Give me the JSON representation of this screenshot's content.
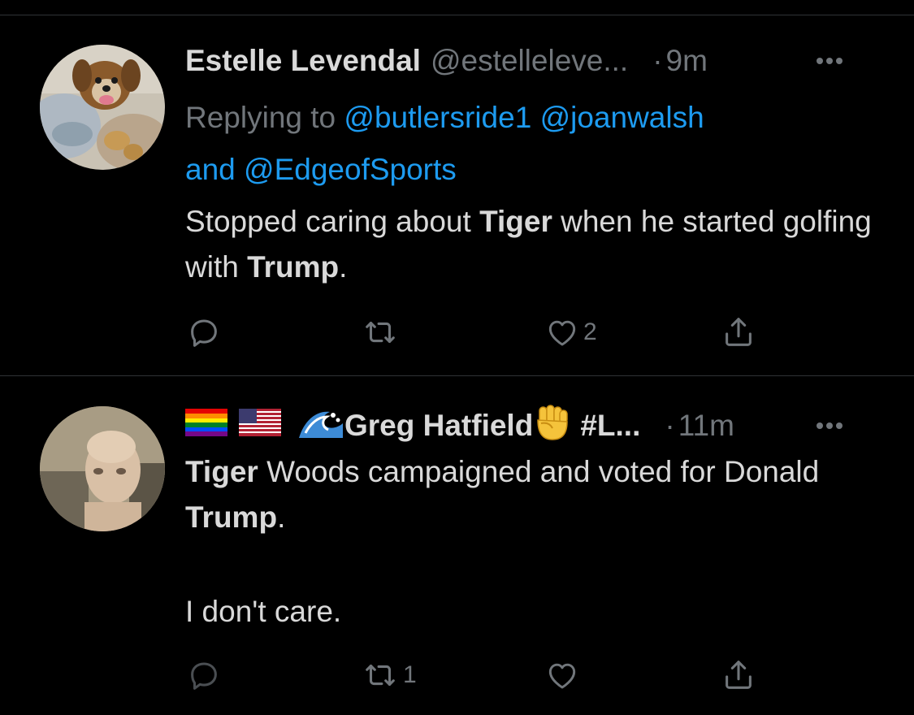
{
  "tweets": [
    {
      "display_name": "Estelle Levendal",
      "handle": "@estelleleve...",
      "dot": "·",
      "time": "9m",
      "reply": {
        "prefix": "Replying to",
        "mention_1": "@butlersride1",
        "mention_2": "@joanwalsh",
        "joiner": "and",
        "mention_3": "@EdgeofSports"
      },
      "body": {
        "t1": "Stopped caring about ",
        "b1": "Tiger",
        "t2": " when he started golfing with ",
        "b2": "Trump",
        "t3": "."
      },
      "actions": {
        "reply_count": "",
        "retweet_count": "",
        "like_count": "2"
      }
    },
    {
      "display_name": "Greg Hatfield",
      "handle_truncated": "#L...",
      "dot": "·",
      "time": "11m",
      "body": {
        "b1": "Tiger",
        "t1": " Woods campaigned and voted for Donald ",
        "b2": "Trump",
        "t2": ".",
        "p2": "I don't care."
      },
      "actions": {
        "reply_count": "",
        "retweet_count": "1",
        "like_count": ""
      }
    }
  ],
  "icons": {
    "reply": "reply-icon",
    "retweet": "retweet-icon",
    "like": "heart-icon",
    "share": "share-icon",
    "more": "more-dots-icon"
  },
  "colors": {
    "background": "#000000",
    "text": "#d9d9d9",
    "secondary": "#71767b",
    "link": "#1d9bf0",
    "divider": "#2f3336"
  }
}
